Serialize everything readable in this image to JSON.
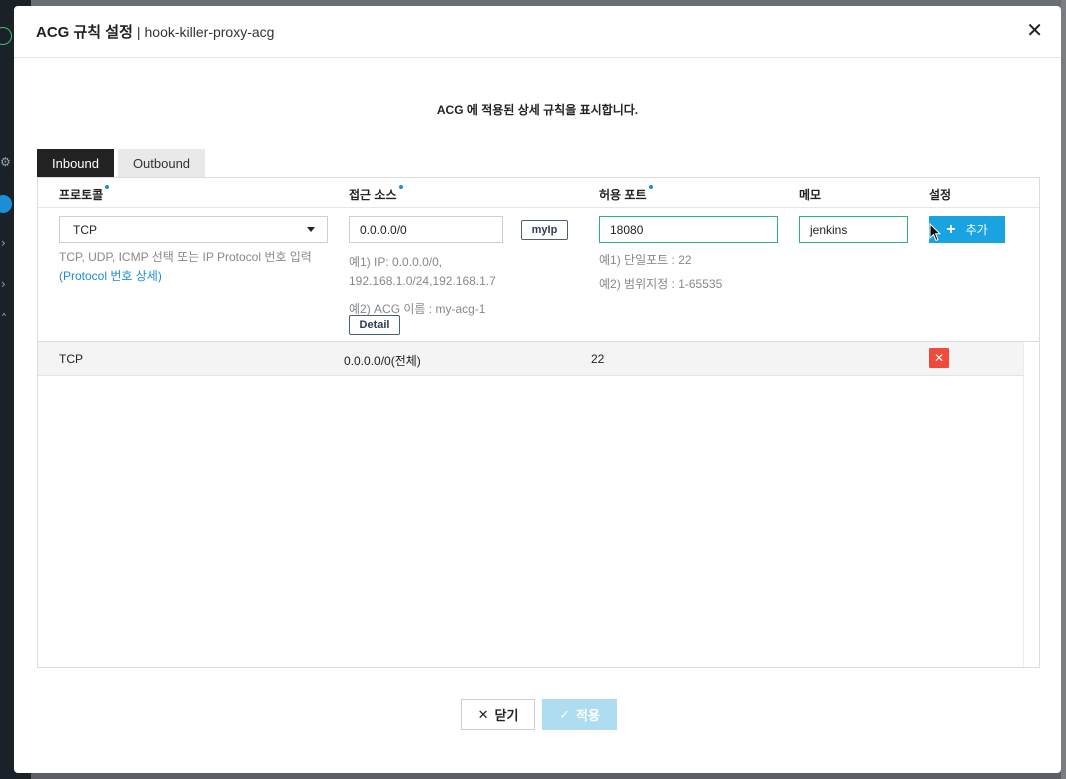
{
  "modal": {
    "title": "ACG 규칙 설정",
    "separator": "|",
    "acg_name": "hook-killer-proxy-acg",
    "close_glyph": "✕",
    "description": "ACG 에 적용된 상세 규칙을 표시합니다."
  },
  "tabs": [
    {
      "label": "Inbound",
      "active": true
    },
    {
      "label": "Outbound",
      "active": false
    }
  ],
  "table": {
    "headers": {
      "protocol": "프로토콜",
      "source": "접근 소스",
      "port": "허용 포트",
      "memo": "메모",
      "setting": "설정"
    }
  },
  "form": {
    "protocol_value": "TCP",
    "protocol_help": "TCP, UDP, ICMP 선택 또는 IP Protocol 번호 입력",
    "protocol_link_open": "(",
    "protocol_link": "Protocol 번호 상세",
    "protocol_link_close": ")",
    "source_value": "0.0.0.0/0",
    "myip_label": "myIp",
    "source_help_1": "예1) IP: 0.0.0.0/0,",
    "source_help_1b": "192.168.1.0/24,192.168.1.7",
    "source_help_2": "예2) ACG 이름 : my-acg-1",
    "detail_label": "Detail",
    "port_value": "18080",
    "port_help_1": "예1) 단일포트 : 22",
    "port_help_2": "예2) 범위지정 : 1-65535",
    "memo_value": "jenkins",
    "add_label": "추가",
    "add_icon": "+"
  },
  "rules": [
    {
      "protocol": "TCP",
      "source": "0.0.0.0/0(전체)",
      "port": "22",
      "memo": "",
      "delete_glyph": "✕"
    }
  ],
  "footer": {
    "close_label": "닫기",
    "close_icon": "✕",
    "apply_label": "적용",
    "apply_icon": "✓"
  },
  "colors": {
    "accent": "#19a3e0",
    "valid_border": "#2bb673",
    "delete": "#ef4a3c",
    "apply_disabled": "#aedcf1"
  }
}
